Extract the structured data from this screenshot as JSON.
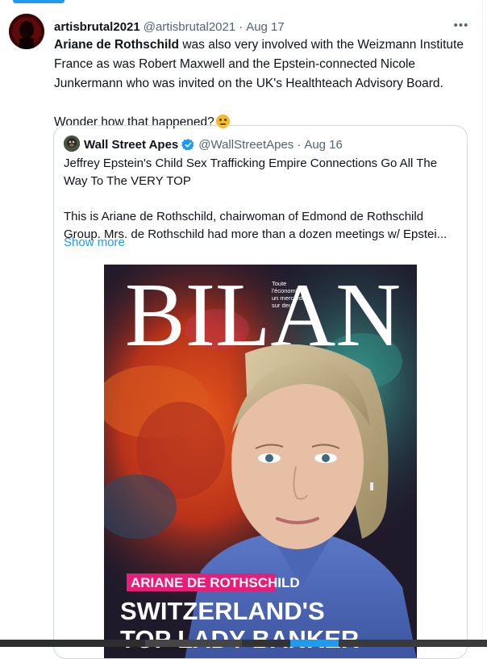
{
  "tweet": {
    "display_name": "artisbrutal2021",
    "handle": "@artisbrutal2021",
    "separator": "·",
    "date": "Aug 17",
    "more_icon": "more-horizontal-icon",
    "text_bold": "Ariane de Rothschild",
    "text_rest": " was also very involved with the Weizmann Institute France as was Robert Maxwell and the Epstein-connected Nicole Junkermann who was invited on the UK's Healthteach Advisory Board.",
    "text_line2": "Wonder how that happened?",
    "emoji": "thinking-face-icon"
  },
  "quoted": {
    "display_name": "Wall Street Apes",
    "verified_icon": "verified-badge-icon",
    "handle": "@WallStreetApes",
    "separator": "·",
    "date": "Aug 16",
    "paragraph1": "Jeffrey Epstein's Child Sex Trafficking Empire Connections Go All The Way To The VERY TOP",
    "paragraph2": "This is Ariane de Rothschild, chairwoman of Edmond de Rothschild Group. Mrs. de Rothschild had more than a dozen meetings w/ Epstei...",
    "show_more": "Show more",
    "media": {
      "masthead": "BILAN",
      "tagline": [
        "Toute",
        "l'économie",
        "un mercredi",
        "sur deux"
      ],
      "cover_label": "ARIANE DE ROTHSCHILD",
      "headline_1": "SWITZERLAND'S",
      "headline_2": "TOP LADY BANKER"
    }
  },
  "colors": {
    "accent": "#1d9bf0",
    "text": "#0f1419",
    "muted": "#536471",
    "border": "#cfd9de",
    "cover_label_bg": "#e61e7a"
  }
}
